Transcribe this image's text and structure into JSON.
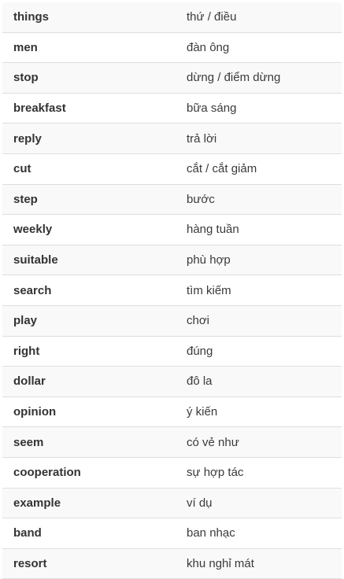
{
  "vocabulary": [
    {
      "word": "things",
      "meaning": "thứ / điều"
    },
    {
      "word": "men",
      "meaning": "đàn ông"
    },
    {
      "word": "stop",
      "meaning": "dừng / điểm dừng"
    },
    {
      "word": "breakfast",
      "meaning": "bữa sáng"
    },
    {
      "word": "reply",
      "meaning": "trả lời"
    },
    {
      "word": "cut",
      "meaning": "cắt / cắt giảm"
    },
    {
      "word": "step",
      "meaning": "bước"
    },
    {
      "word": "weekly",
      "meaning": "hàng tuần"
    },
    {
      "word": "suitable",
      "meaning": "phù hợp"
    },
    {
      "word": "search",
      "meaning": "tìm kiếm"
    },
    {
      "word": "play",
      "meaning": "chơi"
    },
    {
      "word": "right",
      "meaning": "đúng"
    },
    {
      "word": "dollar",
      "meaning": "đô la"
    },
    {
      "word": "opinion",
      "meaning": "ý kiến"
    },
    {
      "word": "seem",
      "meaning": "có vẻ như"
    },
    {
      "word": "cooperation",
      "meaning": "sự hợp tác"
    },
    {
      "word": "example",
      "meaning": "ví dụ"
    },
    {
      "word": "band",
      "meaning": "ban nhạc"
    },
    {
      "word": "resort",
      "meaning": "khu nghỉ mát"
    }
  ]
}
